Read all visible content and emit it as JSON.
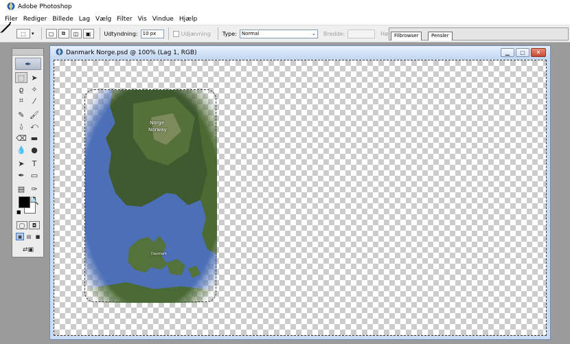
{
  "app": {
    "title": "Adobe Photoshop"
  },
  "menu": [
    "Filer",
    "Rediger",
    "Billede",
    "Lag",
    "Vælg",
    "Filter",
    "Vis",
    "Vindue",
    "Hjælp"
  ],
  "options": {
    "feather_label": "Udtyndning:",
    "feather_value": "10 px",
    "antialias_label": "Udjævning",
    "type_label": "Type:",
    "type_value": "Normal",
    "width_label": "Bredde:",
    "height_label": "Højde:"
  },
  "palette_tabs": [
    "Filbrowser",
    "Pensler"
  ],
  "document": {
    "title": "Danmark Norge.psd @ 100% (Lag 1, RGB)",
    "labels": {
      "norge": "Norge",
      "norway": "Norway",
      "danmark": "Danmark"
    }
  },
  "colors": {
    "foreground": "#000000",
    "background": "#ffffff",
    "close_button": "#c54a36"
  }
}
